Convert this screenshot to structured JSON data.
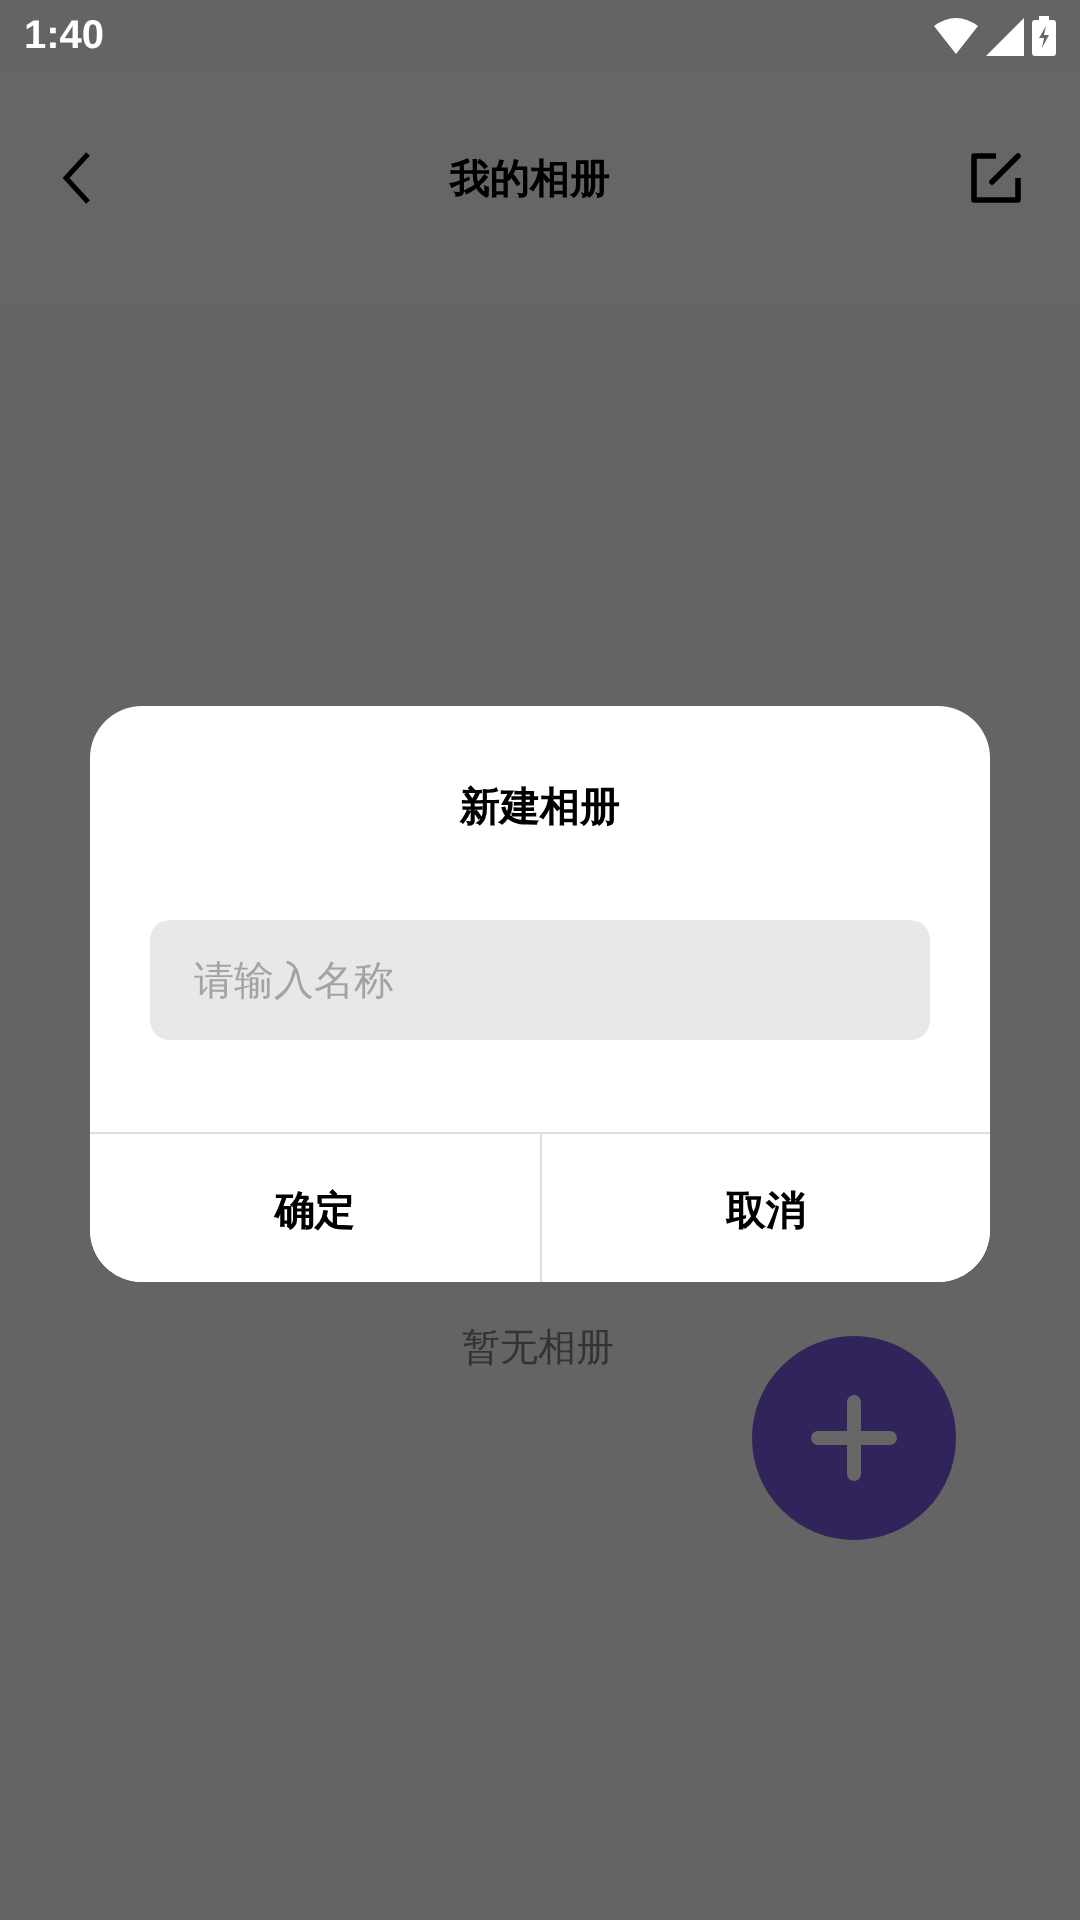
{
  "status_bar": {
    "time": "1:40"
  },
  "header": {
    "title": "我的相册"
  },
  "empty_state": {
    "text": "暂无相册"
  },
  "dialog": {
    "title": "新建相册",
    "input": {
      "placeholder": "请输入名称"
    },
    "buttons": [
      "确定",
      "取消"
    ]
  }
}
